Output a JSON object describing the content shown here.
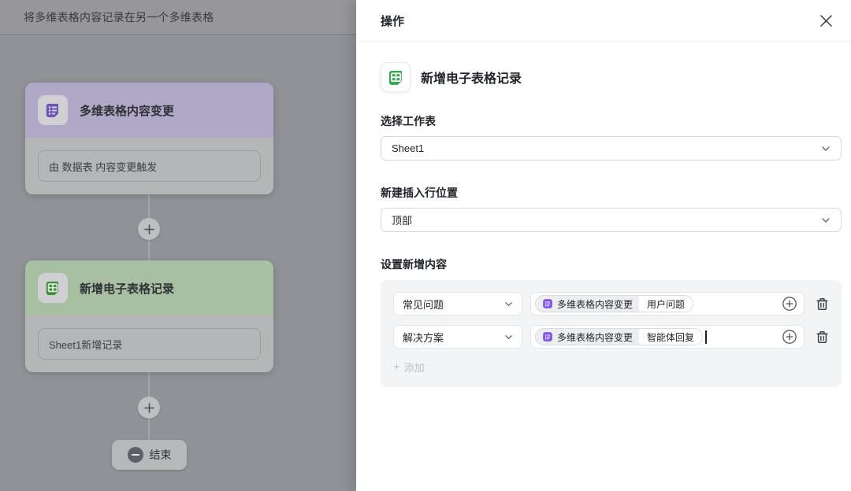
{
  "colors": {
    "bitable_purple": "#7d56e8",
    "sheet_green": "#34a94f",
    "node_header_purple": "#b0a8c6",
    "node_header_green": "#a8bfa2",
    "panel_bg": "#f3f4f6",
    "muted_text": "#bcc0c5"
  },
  "left": {
    "topbar_title": "将多维表格内容记录在另一个多维表格",
    "nodes": [
      {
        "title": "多维表格内容变更",
        "subtitle": "由 数据表 内容变更触发"
      },
      {
        "title": "新增电子表格记录",
        "subtitle": "Sheet1新增记录"
      }
    ],
    "end_label": "结束"
  },
  "panel": {
    "title": "操作",
    "action_title": "新增电子表格记录",
    "worksheet": {
      "label": "选择工作表",
      "value": "Sheet1"
    },
    "insert_position": {
      "label": "新建插入行位置",
      "value": "顶部"
    },
    "content": {
      "label": "设置新增内容",
      "rows": [
        {
          "column": "常见问题",
          "ref_source": "多维表格内容变更",
          "ref_field": "用户问题"
        },
        {
          "column": "解决方案",
          "ref_source": "多维表格内容变更",
          "ref_field": "智能体回复"
        }
      ],
      "add_plus": "+",
      "add_label": "添加"
    }
  }
}
